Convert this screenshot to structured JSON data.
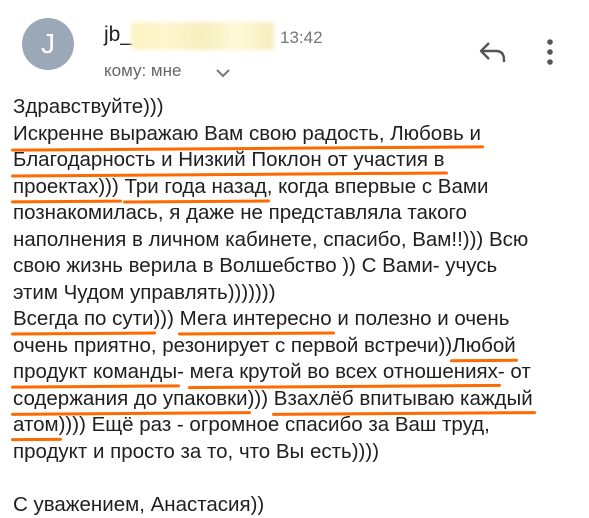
{
  "header": {
    "avatar_letter": "J",
    "sender": "jb_",
    "time": "13:42",
    "recipient": "кому: мне"
  },
  "icons": {
    "chevron": "chevron-down-icon",
    "reply": "reply-icon",
    "more": "more-vert-icon"
  },
  "colors": {
    "underline": "#ff6a00",
    "avatar": "#9aa8b8"
  },
  "message": {
    "l1": "Здравствуйте)))",
    "l2": "Искренне выражаю Вам свою радость, Любовь и",
    "l3": "Благодарность и Низкий Поклон от участия в",
    "l4a": "проектах)))",
    "l4b": " ",
    "l4c": "Три года назад",
    "l4d": ", когда впервые с Вами",
    "l5": "познакомилась, я даже не представляла такого",
    "l6": "наполнения в личном кабинете, спасибо, Вам!!))) Всю",
    "l7": "свою жизнь верила в Волшебство )) С Вами- учусь",
    "l8": "этим Чудом управлять)))))))",
    "l9a": "Всегда по сути",
    "l9b": "))) ",
    "l9c": "Мега интересно",
    "l9d": " и полезно и очень",
    "l10a": "очень приятно, резонирует с первой встречи))",
    "l10b": "Любой",
    "l11a": "продукт команды",
    "l11b": "- ",
    "l11c": "мега крутой во всех отношениях",
    "l11d": "- от",
    "l12a": "содержания до упаковки",
    "l12b": "))) ",
    "l12c": "Взахлёб впитываю каждый",
    "l13a": "атом",
    "l13b": ")))) Ещё раз - огромное спасибо за Ваш труд,",
    "l14": "продукт и просто за то, что Вы есть))))",
    "signature": "С уважением, Анастасия))"
  }
}
